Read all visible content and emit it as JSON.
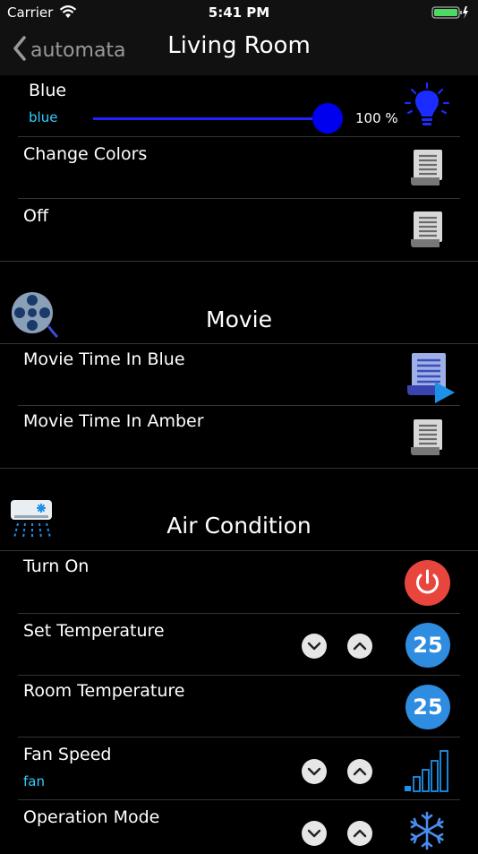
{
  "status_bar": {
    "carrier": "Carrier",
    "time": "5:41 PM"
  },
  "nav": {
    "back_label": "automata",
    "title": "Living Room"
  },
  "light": {
    "title": "Blue",
    "subtitle": "blue",
    "level_percent": 100,
    "level_label": "100 %"
  },
  "scenes_top": [
    {
      "title": "Change Colors"
    },
    {
      "title": "Off"
    }
  ],
  "movie": {
    "section_title": "Movie",
    "items": [
      {
        "title": "Movie Time In Blue"
      },
      {
        "title": "Movie Time In Amber"
      }
    ]
  },
  "air": {
    "section_title": "Air Condition",
    "turn_on": {
      "title": "Turn On"
    },
    "set_temp": {
      "title": "Set Temperature",
      "value": "25"
    },
    "room_temp": {
      "title": "Room Temperature",
      "value": "25"
    },
    "fan_speed": {
      "title": "Fan Speed",
      "subtitle": "fan"
    },
    "operation_mode": {
      "title": "Operation Mode"
    }
  },
  "colors": {
    "accent_cyan": "#33ccff",
    "temp_blue": "#2e8de0",
    "power_red": "#e8463c",
    "slider_blue": "#0000ee"
  }
}
